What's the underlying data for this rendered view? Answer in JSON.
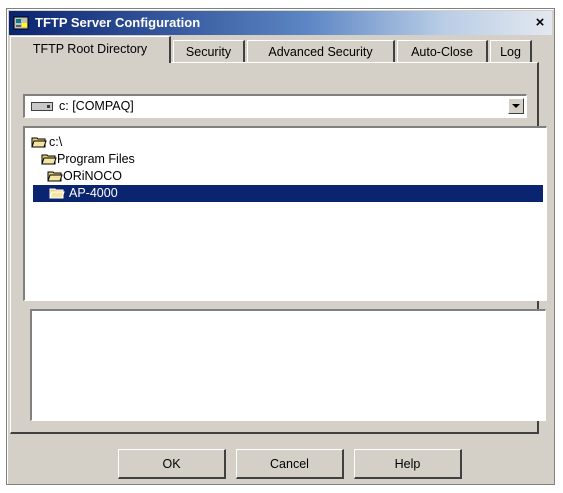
{
  "window": {
    "title": "TFTP Server Configuration",
    "close_label": "×"
  },
  "tabs": [
    {
      "label": "TFTP Root Directory",
      "active": true
    },
    {
      "label": "Security",
      "active": false
    },
    {
      "label": "Advanced Security",
      "active": false
    },
    {
      "label": "Auto-Close",
      "active": false
    },
    {
      "label": "Log",
      "active": false
    }
  ],
  "drive_select": {
    "value": "c: [COMPAQ]"
  },
  "directory_tree": [
    {
      "label": "c:\\",
      "selected": false
    },
    {
      "label": "Program Files",
      "selected": false
    },
    {
      "label": "ORiNOCO",
      "selected": false
    },
    {
      "label": "AP-4000",
      "selected": true
    }
  ],
  "buttons": {
    "ok": "OK",
    "cancel": "Cancel",
    "help": "Help"
  },
  "colors": {
    "dialog_face": "#d4d0c8",
    "selection": "#0a2470",
    "titlebar_start": "#0a2470",
    "folder": "#e8d27a"
  }
}
